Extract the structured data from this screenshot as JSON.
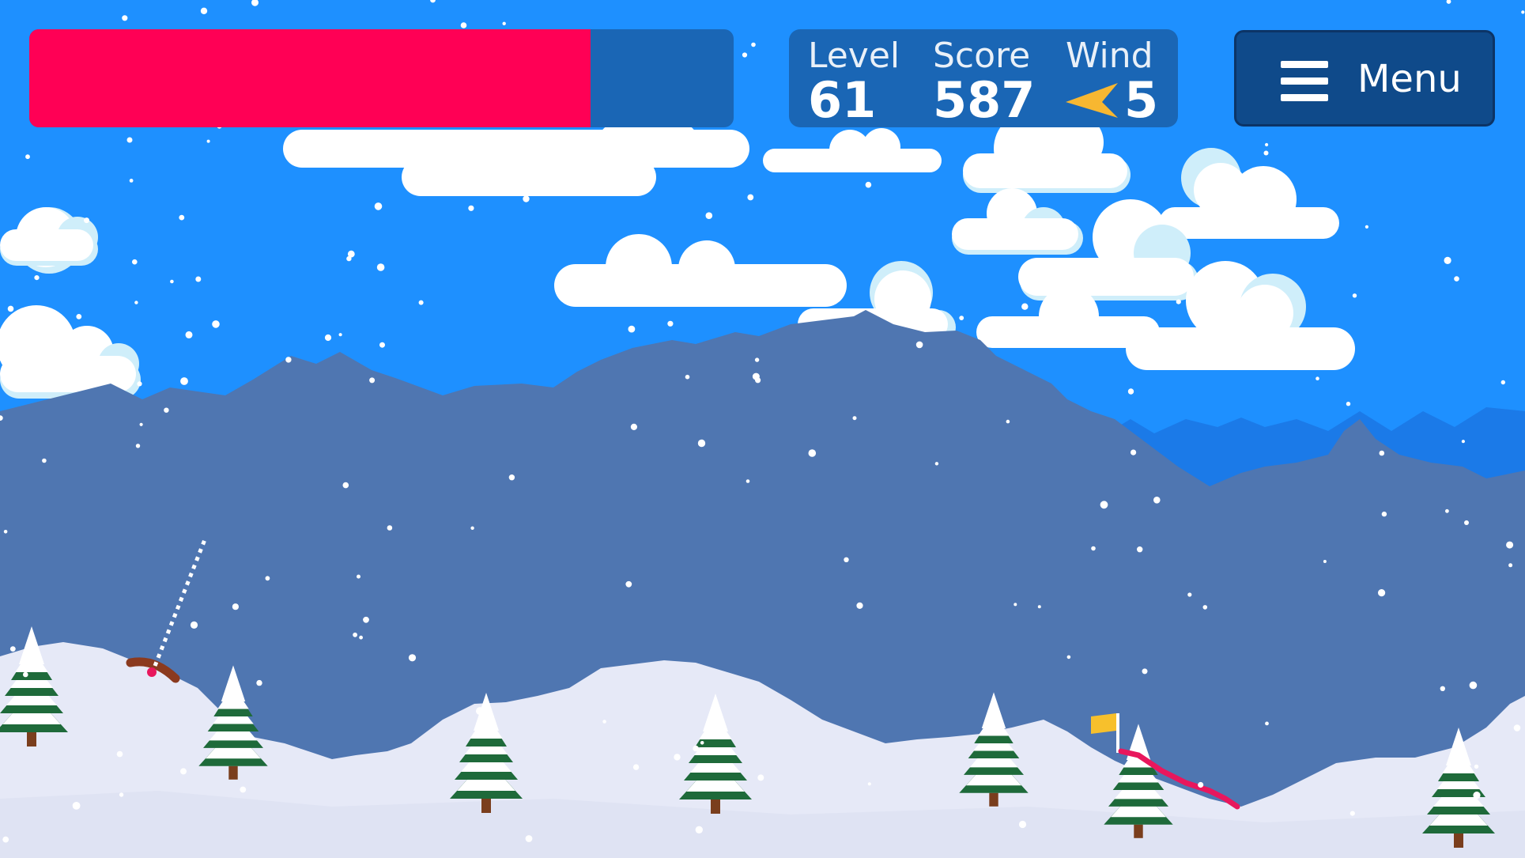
{
  "game": {
    "power": {
      "fraction": 0.797
    },
    "stats": {
      "level": {
        "label": "Level",
        "value": "61"
      },
      "score": {
        "label": "Score",
        "value": "587"
      },
      "wind": {
        "label": "Wind",
        "value": "5",
        "direction": "left",
        "arrow_color": "#f7b731"
      }
    },
    "menu": {
      "label": "Menu",
      "icon": "hamburger-icon"
    },
    "colors": {
      "sky": "#1e90ff",
      "mountains_far": "#1b7ae8",
      "mountains_near": "#4f76b1",
      "snow_ground": "#e6e9f7",
      "power_fill": "#ff0055",
      "hud_panel": "#1a66b5",
      "flag": "#f7c02c",
      "putt_trail": "#e8175d"
    }
  }
}
